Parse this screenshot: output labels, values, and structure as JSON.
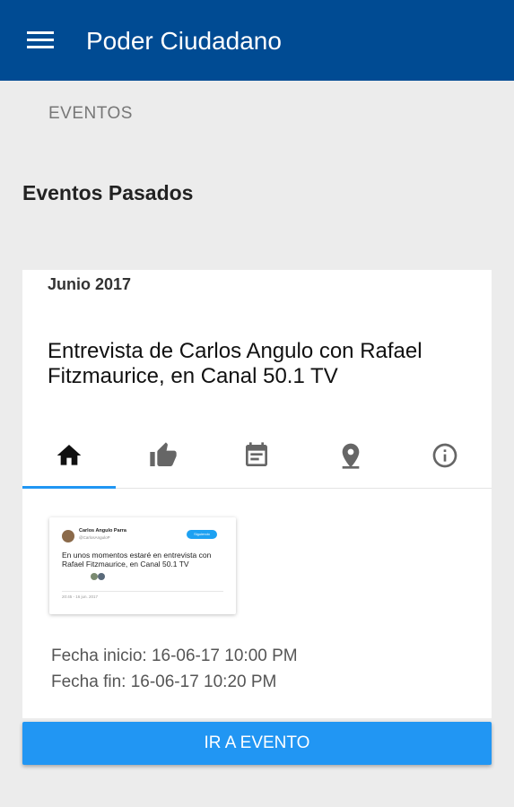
{
  "appbar": {
    "title": "Poder Ciudadano",
    "menu_icon": "menu-icon",
    "background": "#004b93"
  },
  "section": {
    "label": "EVENTOS"
  },
  "page": {
    "heading": "Eventos Pasados"
  },
  "event": {
    "month": "Junio 2017",
    "title": "Entrevista de Carlos Angulo con Rafael Fitzmaurice, en Canal 50.1 TV",
    "tabs": [
      {
        "icon": "home-icon",
        "selected": true
      },
      {
        "icon": "thumb-up-icon",
        "selected": false
      },
      {
        "icon": "calendar-event-icon",
        "selected": false
      },
      {
        "icon": "location-pin-icon",
        "selected": false
      },
      {
        "icon": "info-icon",
        "selected": false
      }
    ],
    "tweet_preview": {
      "author": "Carlos Angulo Parra",
      "handle": "@CarlosAnguloP",
      "follow_label": "Siguiendo",
      "text": "En unos momentos estaré en entrevista con Rafael Fitzmaurice, en Canal 50.1 TV",
      "meta": "20:45 - 16 jun. 2017"
    },
    "start": "Fecha inicio: 16-06-17 10:00 PM",
    "end": "Fecha fin: 16-06-17 10:20 PM"
  },
  "cta": {
    "label": "IR A EVENTO",
    "color": "#2196f3"
  }
}
